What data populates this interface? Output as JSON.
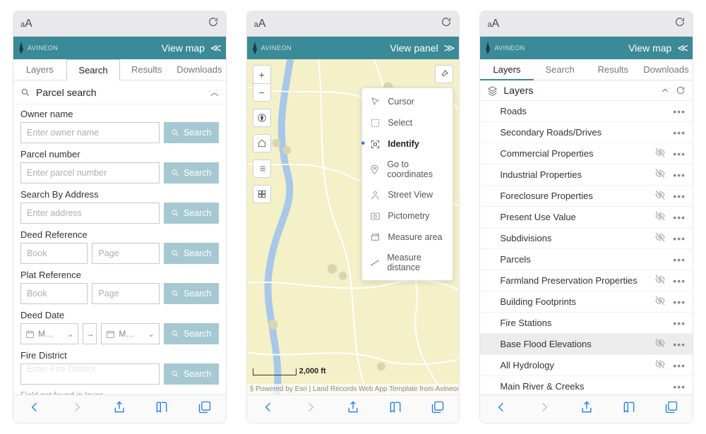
{
  "browser": {
    "aa": "A",
    "aa_small": "a"
  },
  "logo_text": "AVINEON",
  "panels": {
    "search": {
      "header_label": "View map",
      "tabs": [
        "Layers",
        "Search",
        "Results",
        "Downloads"
      ],
      "section_title": "Parcel search",
      "fields": {
        "owner": {
          "label": "Owner name",
          "placeholder": "Enter owner name"
        },
        "parcel": {
          "label": "Parcel number",
          "placeholder": "Enter parcel number"
        },
        "address": {
          "label": "Search By Address",
          "placeholder": "Enter address"
        },
        "deedref": {
          "label": "Deed Reference",
          "book": "Book",
          "page": "Page"
        },
        "platref": {
          "label": "Plat Reference",
          "book": "Book",
          "page": "Page"
        },
        "deeddate": {
          "label": "Deed Date",
          "value": "M…"
        },
        "fire": {
          "label": "Fire District",
          "placeholder": "Enter Fire District"
        }
      },
      "search_btn": "Search",
      "note": "Field not found in layer."
    },
    "map": {
      "header_label": "View panel",
      "tools": [
        {
          "id": "cursor",
          "label": "Cursor"
        },
        {
          "id": "select",
          "label": "Select"
        },
        {
          "id": "identify",
          "label": "Identify",
          "selected": true
        },
        {
          "id": "goto",
          "label": "Go to coordinates"
        },
        {
          "id": "streetview",
          "label": "Street View"
        },
        {
          "id": "pictometry",
          "label": "Pictometry"
        },
        {
          "id": "measure-area",
          "label": "Measure area"
        },
        {
          "id": "measure-dist",
          "label": "Measure distance"
        }
      ],
      "scale": "2,000 ft",
      "attribution": "Powered by Esri | Land Records Web App Template from Avineon,"
    },
    "layers": {
      "header_label": "View map",
      "tabs": [
        "Layers",
        "Search",
        "Results",
        "Downloads"
      ],
      "section_title": "Layers",
      "items": [
        {
          "name": "Roads",
          "hidden": false
        },
        {
          "name": "Secondary Roads/Drives",
          "hidden": false
        },
        {
          "name": "Commercial Properties",
          "hidden": true
        },
        {
          "name": "Industrial Properties",
          "hidden": true
        },
        {
          "name": "Foreclosure Properties",
          "hidden": true
        },
        {
          "name": "Present Use Value",
          "hidden": true
        },
        {
          "name": "Subdivisions",
          "hidden": true
        },
        {
          "name": "Parcels",
          "hidden": false
        },
        {
          "name": "Farmland Preservation Properties",
          "hidden": true
        },
        {
          "name": "Building Footprints",
          "hidden": true
        },
        {
          "name": "Fire Stations",
          "hidden": false
        },
        {
          "name": "Base Flood Elevations",
          "hidden": true,
          "highlight": true
        },
        {
          "name": "All Hydrology",
          "hidden": true
        },
        {
          "name": "Main River & Creeks",
          "hidden": false
        }
      ]
    }
  }
}
